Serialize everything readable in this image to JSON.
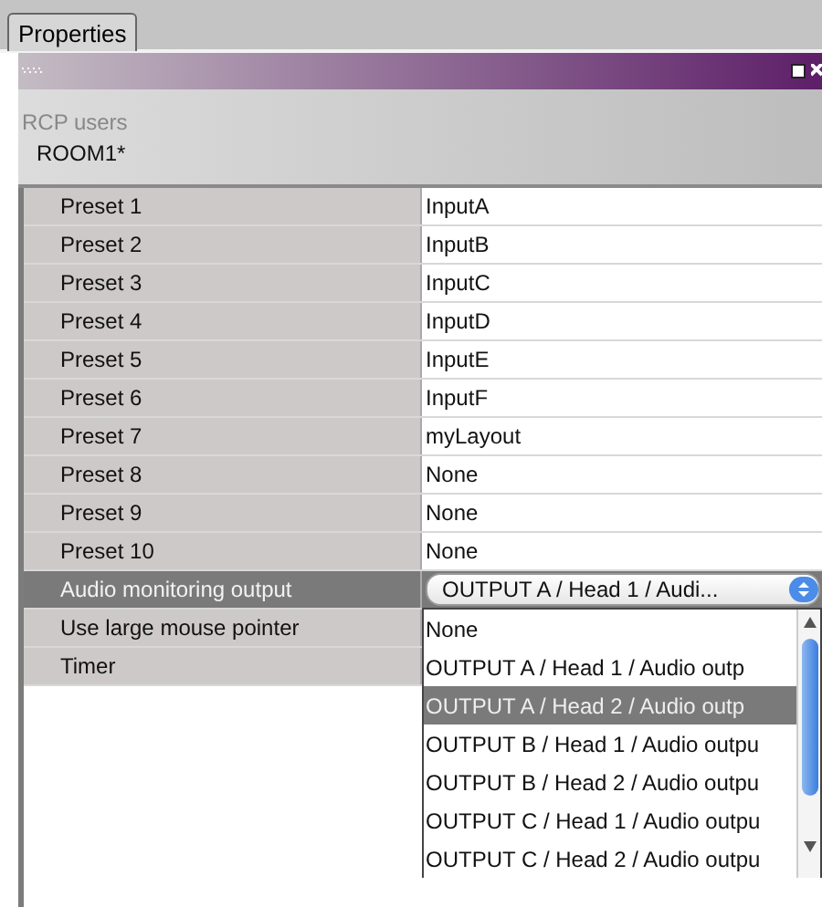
{
  "tabs": [
    {
      "label": "Properties",
      "selected": true
    }
  ],
  "header": {
    "group": "RCP users",
    "name": "ROOM1*"
  },
  "rows": [
    {
      "label": "Preset 1",
      "kind": "text",
      "value": "InputA",
      "selected": false
    },
    {
      "label": "Preset 2",
      "kind": "text",
      "value": "InputB",
      "selected": false
    },
    {
      "label": "Preset 3",
      "kind": "text",
      "value": "InputC",
      "selected": false
    },
    {
      "label": "Preset 4",
      "kind": "text",
      "value": "InputD",
      "selected": false
    },
    {
      "label": "Preset 5",
      "kind": "text",
      "value": "InputE",
      "selected": false
    },
    {
      "label": "Preset 6",
      "kind": "text",
      "value": "InputF",
      "selected": false
    },
    {
      "label": "Preset 7",
      "kind": "text",
      "value": "myLayout",
      "selected": false
    },
    {
      "label": "Preset 8",
      "kind": "text",
      "value": "None",
      "selected": false
    },
    {
      "label": "Preset 9",
      "kind": "text",
      "value": "None",
      "selected": false
    },
    {
      "label": "Preset 10",
      "kind": "text",
      "value": "None",
      "selected": false
    },
    {
      "label": "Audio monitoring output",
      "kind": "select",
      "value": "OUTPUT A / Head 1 / Audi...",
      "selected": true,
      "expanded": true,
      "options": [
        {
          "label": "None",
          "selected": false
        },
        {
          "label": "OUTPUT A / Head 1 / Audio outp",
          "selected": false
        },
        {
          "label": "OUTPUT A / Head 2 / Audio outp",
          "selected": true
        },
        {
          "label": "OUTPUT B / Head 1 / Audio outpu",
          "selected": false
        },
        {
          "label": "OUTPUT B / Head 2 / Audio outpu",
          "selected": false
        },
        {
          "label": "OUTPUT C / Head 1 / Audio outpu",
          "selected": false
        },
        {
          "label": "OUTPUT C / Head 2 / Audio outpu",
          "selected": false
        }
      ]
    },
    {
      "label": "Use large mouse pointer",
      "kind": "empty",
      "selected": false
    },
    {
      "label": "Timer",
      "kind": "empty",
      "selected": false
    }
  ]
}
